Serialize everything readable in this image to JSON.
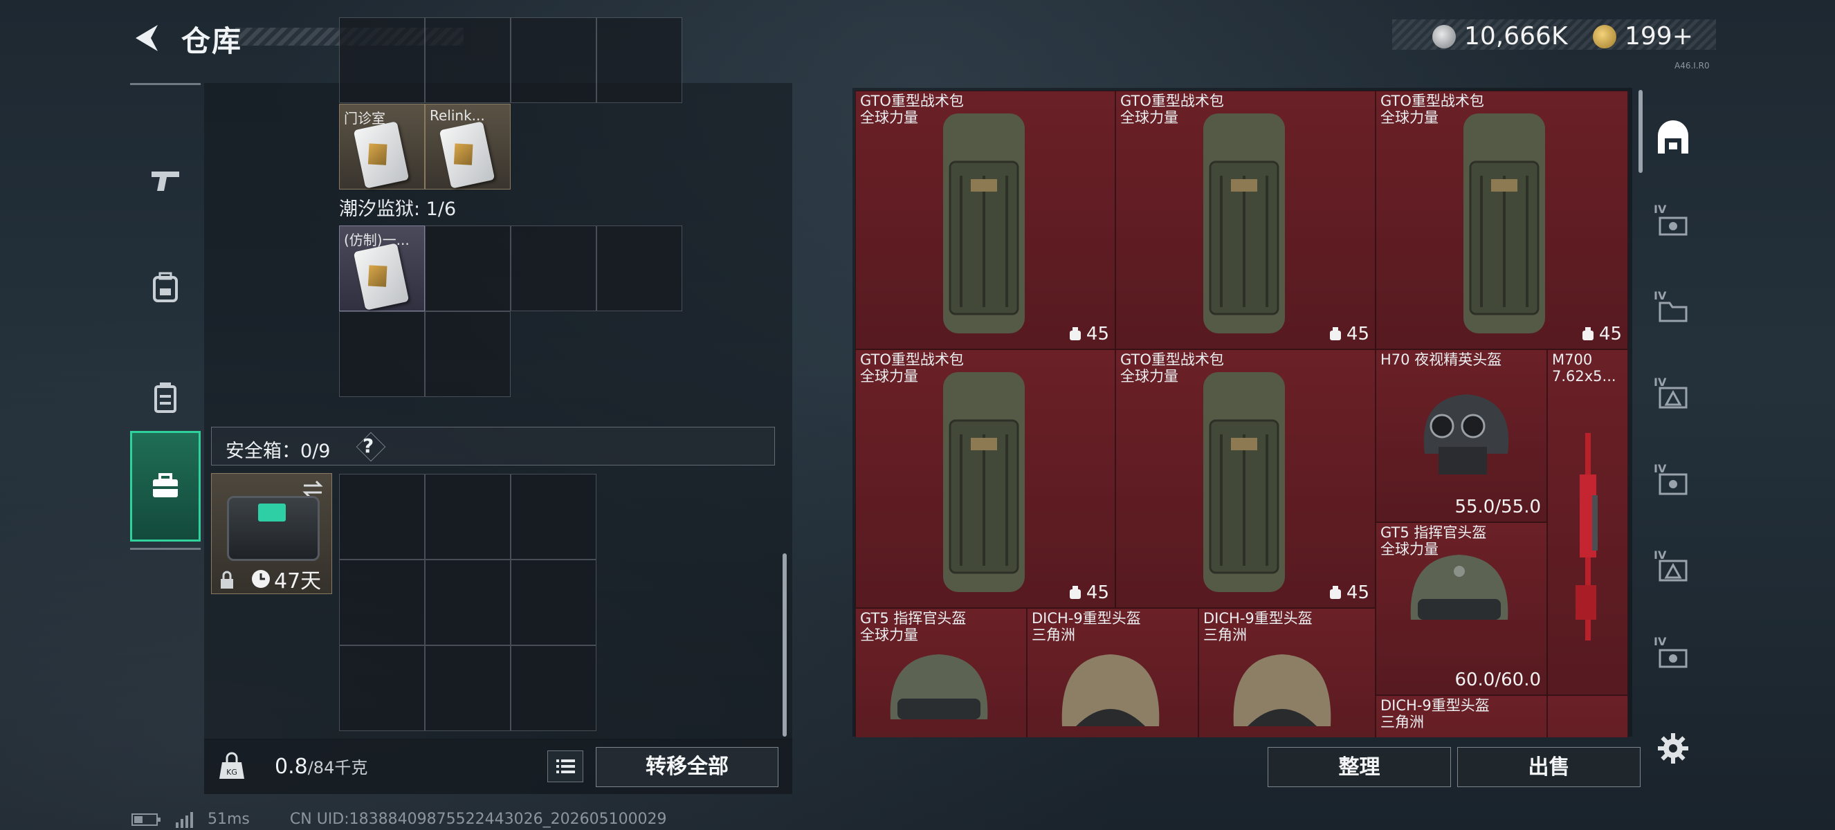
{
  "header": {
    "title": "仓库",
    "currency": [
      {
        "icon": "silver-coin-icon",
        "value": "10,666K"
      },
      {
        "icon": "gold-coin-icon",
        "value": "199+"
      }
    ],
    "version": "A46.I.R0"
  },
  "left_nav": [
    {
      "icon": "pistol-icon"
    },
    {
      "icon": "backpack-icon"
    },
    {
      "icon": "vest-icon"
    },
    {
      "icon": "briefcase-icon",
      "active": true
    }
  ],
  "stash": {
    "top_items": [
      {
        "label": "门诊室"
      },
      {
        "label": "Relink..."
      }
    ],
    "prison_label": "潮汐监狱: 1/6",
    "prison_items": [
      {
        "label": "(仿制)一..."
      }
    ],
    "safe_label": "安全箱：0/9",
    "safe_help": "?",
    "safebox_days": "47天"
  },
  "weight": {
    "current": "0.8",
    "total": "/84千克"
  },
  "transfer_all": "转移全部",
  "right_grid": {
    "items": [
      {
        "name": "GTO重型战术包",
        "sub": "全球力量",
        "count": "45"
      },
      {
        "name": "GTO重型战术包",
        "sub": "全球力量",
        "count": "45"
      },
      {
        "name": "GTO重型战术包",
        "sub": "全球力量",
        "count": "45"
      },
      {
        "name": "GTO重型战术包",
        "sub": "全球力量",
        "count": "45"
      },
      {
        "name": "GTO重型战术包",
        "sub": "全球力量",
        "count": "45"
      },
      {
        "name": "H70 夜视精英头盔",
        "sub": "",
        "durability": "55.0/55.0"
      },
      {
        "name": "M700",
        "sub": "7.62x5..."
      },
      {
        "name": "GT5 指挥官头盔",
        "sub": "全球力量",
        "durability": "60.0/60.0"
      },
      {
        "name": "GT5 指挥官头盔",
        "sub": "全球力量"
      },
      {
        "name": "DICH-9重型头盔",
        "sub": "三角洲"
      },
      {
        "name": "DICH-9重型头盔",
        "sub": "三角洲"
      },
      {
        "name": "DICH-9重型头盔",
        "sub": "三角洲"
      }
    ]
  },
  "buttons": {
    "sort": "整理",
    "sell": "出售"
  },
  "status": {
    "ping": "51ms",
    "uid": "CN UID:1838840987552244302​6_202605100029"
  }
}
